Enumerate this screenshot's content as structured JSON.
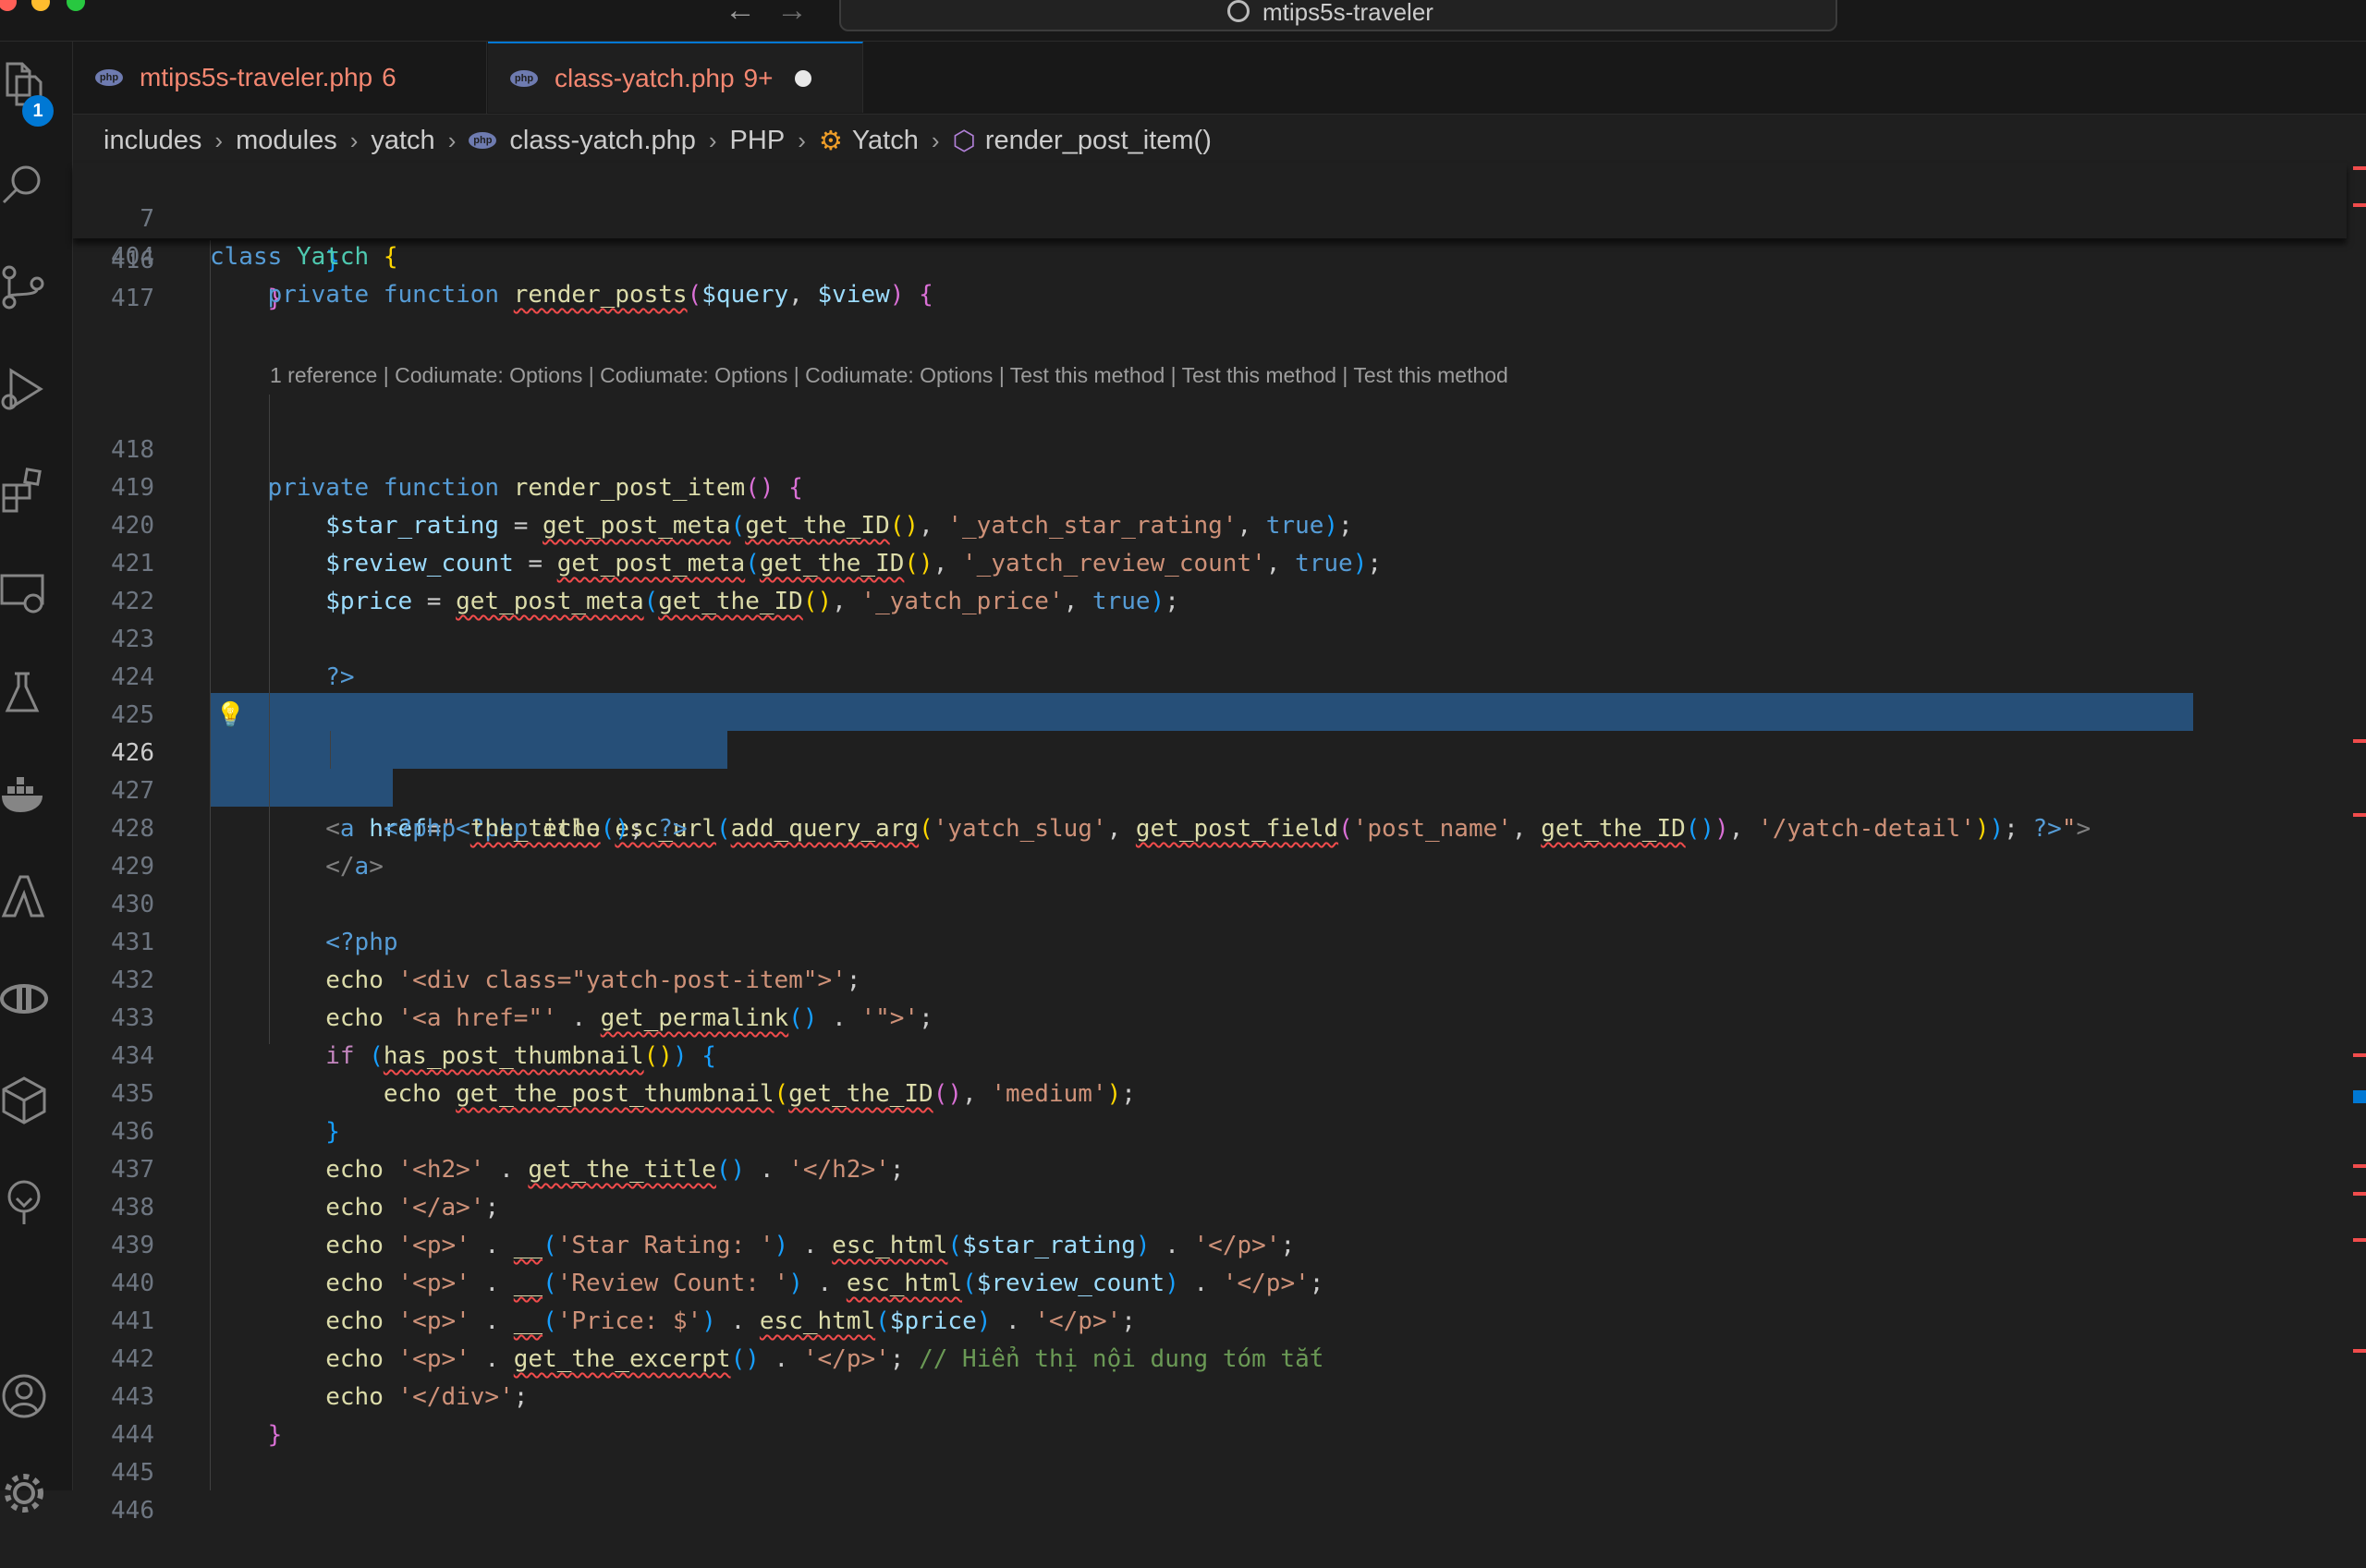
{
  "window": {
    "title": "mtips5s-traveler"
  },
  "tabs": [
    {
      "name": "mtips5s-traveler.php",
      "problems": "6",
      "active": false
    },
    {
      "name": "class-yatch.php",
      "problems": "9+",
      "active": true,
      "dirty": true
    }
  ],
  "activity_badge": "1",
  "breadcrumb": [
    "includes",
    "modules",
    "yatch",
    "class-yatch.php",
    "PHP",
    "Yatch",
    "render_post_item()"
  ],
  "code_lens": "1 reference | Codiumate: Options | Codiumate: Options | Codiumate: Options | Test this method | Test this method | Test this method",
  "sticky_lines": [
    {
      "num": "7",
      "text": "class Yatch {"
    },
    {
      "num": "404",
      "text": "    private function render_posts($query, $view) {"
    }
  ],
  "code_lines": [
    {
      "num": "415",
      "text": "        }"
    },
    {
      "num": "416",
      "text": "    }"
    },
    {
      "num": "417",
      "text": ""
    },
    {
      "num": "418",
      "text": "    private function render_post_item() {"
    },
    {
      "num": "419",
      "text": "        $star_rating = get_post_meta(get_the_ID(), '_yatch_star_rating', true);"
    },
    {
      "num": "420",
      "text": "        $review_count = get_post_meta(get_the_ID(), '_yatch_review_count', true);"
    },
    {
      "num": "421",
      "text": "        $price = get_post_meta(get_the_ID(), '_yatch_price', true);"
    },
    {
      "num": "422",
      "text": ""
    },
    {
      "num": "423",
      "text": "        ?>"
    },
    {
      "num": "424",
      "text": ""
    },
    {
      "num": "425",
      "text": ""
    },
    {
      "num": "426",
      "text": "        <a href=\"<?php echo esc_url(add_query_arg('yatch_slug', get_post_field('post_name', get_the_ID()), '/yatch-detail')); ?>\">"
    },
    {
      "num": "427",
      "text": "            <?php the_title(); ?>"
    },
    {
      "num": "428",
      "text": "        </a>"
    },
    {
      "num": "429",
      "text": ""
    },
    {
      "num": "430",
      "text": "        <?php"
    },
    {
      "num": "431",
      "text": "        echo '<div class=\"yatch-post-item\">';"
    },
    {
      "num": "432",
      "text": "        echo '<a href=\"' . get_permalink() . '\">';"
    },
    {
      "num": "433",
      "text": "        if (has_post_thumbnail()) {"
    },
    {
      "num": "434",
      "text": "            echo get_the_post_thumbnail(get_the_ID(), 'medium');"
    },
    {
      "num": "435",
      "text": "        }"
    },
    {
      "num": "436",
      "text": "        echo '<h2>' . get_the_title() . '</h2>';"
    },
    {
      "num": "437",
      "text": "        echo '</a>';"
    },
    {
      "num": "438",
      "text": "        echo '<p>' . __('Star Rating: ') . esc_html($star_rating) . '</p>';"
    },
    {
      "num": "439",
      "text": "        echo '<p>' . __('Review Count: ') . esc_html($review_count) . '</p>';"
    },
    {
      "num": "440",
      "text": "        echo '<p>' . __('Price: $') . esc_html($price) . '</p>';"
    },
    {
      "num": "441",
      "text": "        echo '<p>' . get_the_excerpt() . '</p>'; // Hiển thị nội dung tóm tắt"
    },
    {
      "num": "442",
      "text": "        echo '</div>';"
    },
    {
      "num": "443",
      "text": "    }"
    },
    {
      "num": "444",
      "text": ""
    },
    {
      "num": "445",
      "text": ""
    },
    {
      "num": "446",
      "text": ""
    }
  ],
  "current_line": "426",
  "colors": {
    "accent": "#0078d4",
    "selection": "#264f78",
    "error": "#f48771",
    "background": "#1f1f1f"
  }
}
